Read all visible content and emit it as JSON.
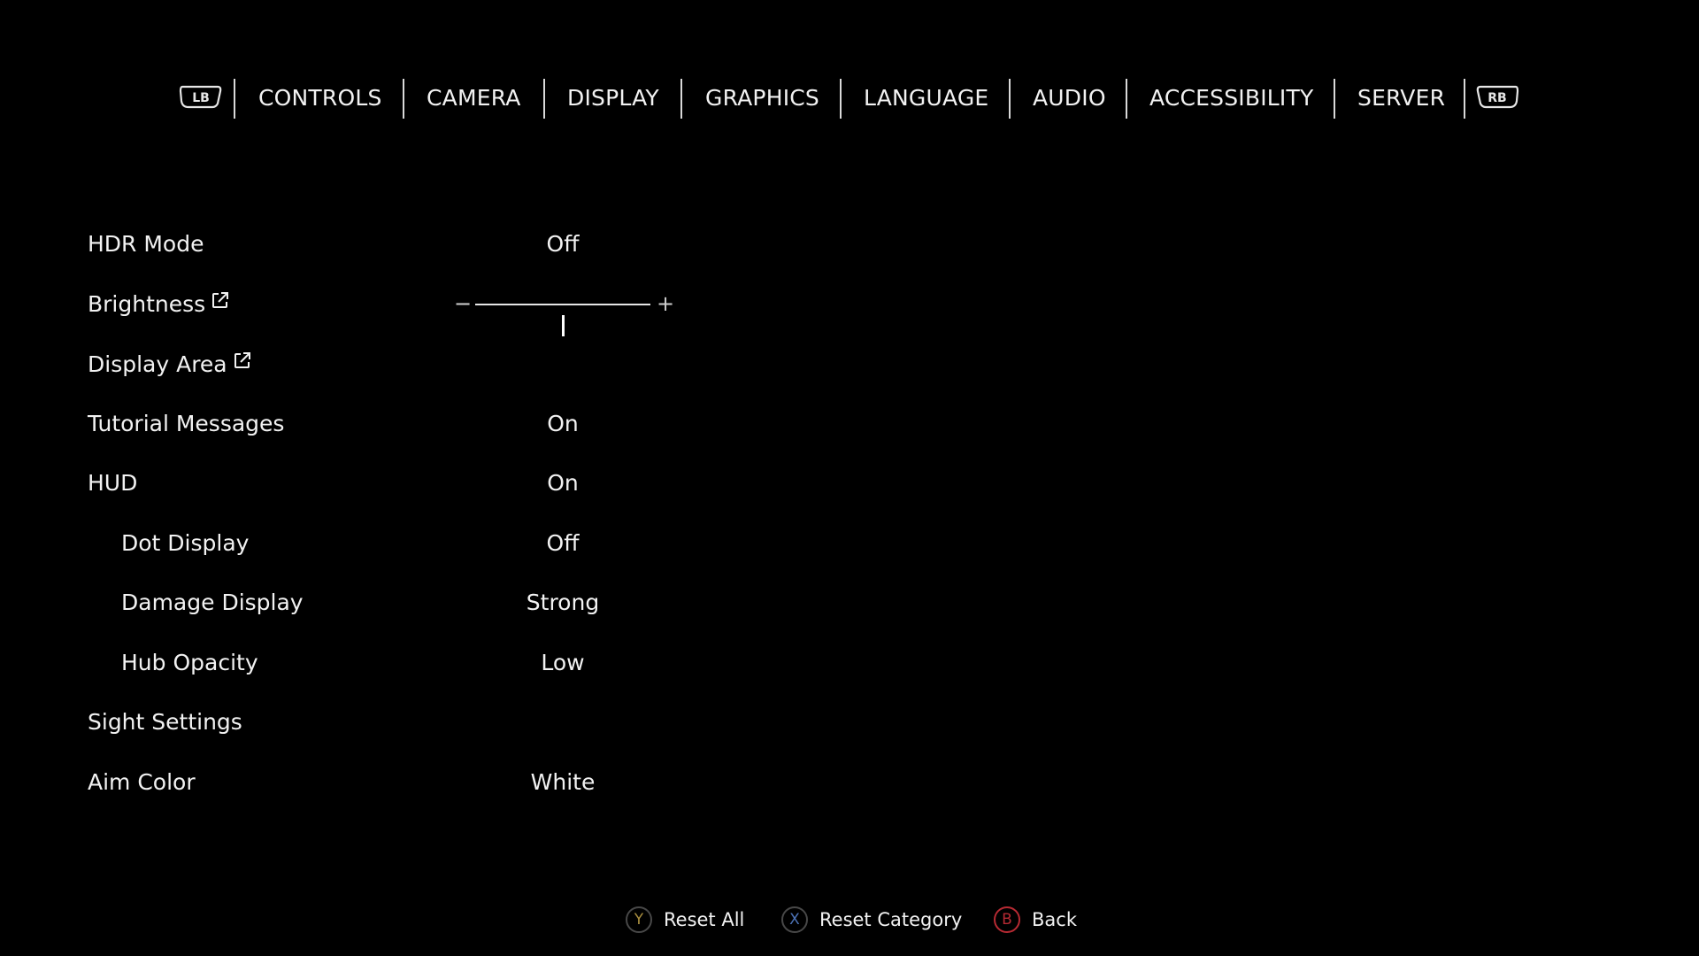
{
  "colors": {
    "background": "#000000",
    "text": "#f2f2f2",
    "divider": "#d9d9d9",
    "y_button": "#c8a94a",
    "x_button": "#5a86d6",
    "b_button": "#d8323c"
  },
  "tabbar": {
    "left_bumper": "LB",
    "right_bumper": "RB",
    "tabs": [
      {
        "label": "CONTROLS"
      },
      {
        "label": "CAMERA"
      },
      {
        "label": "DISPLAY"
      },
      {
        "label": "GRAPHICS"
      },
      {
        "label": "LANGUAGE"
      },
      {
        "label": "AUDIO"
      },
      {
        "label": "ACCESSIBILITY"
      },
      {
        "label": "SERVER"
      }
    ]
  },
  "settings": {
    "hdr_mode": {
      "label": "HDR Mode",
      "value": "Off"
    },
    "brightness": {
      "label": "Brightness",
      "icon": "external-link-icon",
      "minus": "−",
      "plus": "+",
      "level": 0.5
    },
    "display_area": {
      "label": "Display Area",
      "icon": "external-link-icon"
    },
    "tutorial_messages": {
      "label": "Tutorial Messages",
      "value": "On"
    },
    "hud": {
      "label": "HUD",
      "value": "On"
    },
    "dot_display": {
      "label": "Dot Display",
      "value": "Off"
    },
    "damage_display": {
      "label": "Damage Display",
      "value": "Strong"
    },
    "hub_opacity": {
      "label": "Hub Opacity",
      "value": "Low"
    },
    "sight_settings": {
      "label": "Sight Settings"
    },
    "aim_color": {
      "label": "Aim Color",
      "value": "White"
    }
  },
  "footer": {
    "reset_all": {
      "button": "Y",
      "label": "Reset All"
    },
    "reset_category": {
      "button": "X",
      "label": "Reset Category"
    },
    "back": {
      "button": "B",
      "label": "Back"
    }
  }
}
